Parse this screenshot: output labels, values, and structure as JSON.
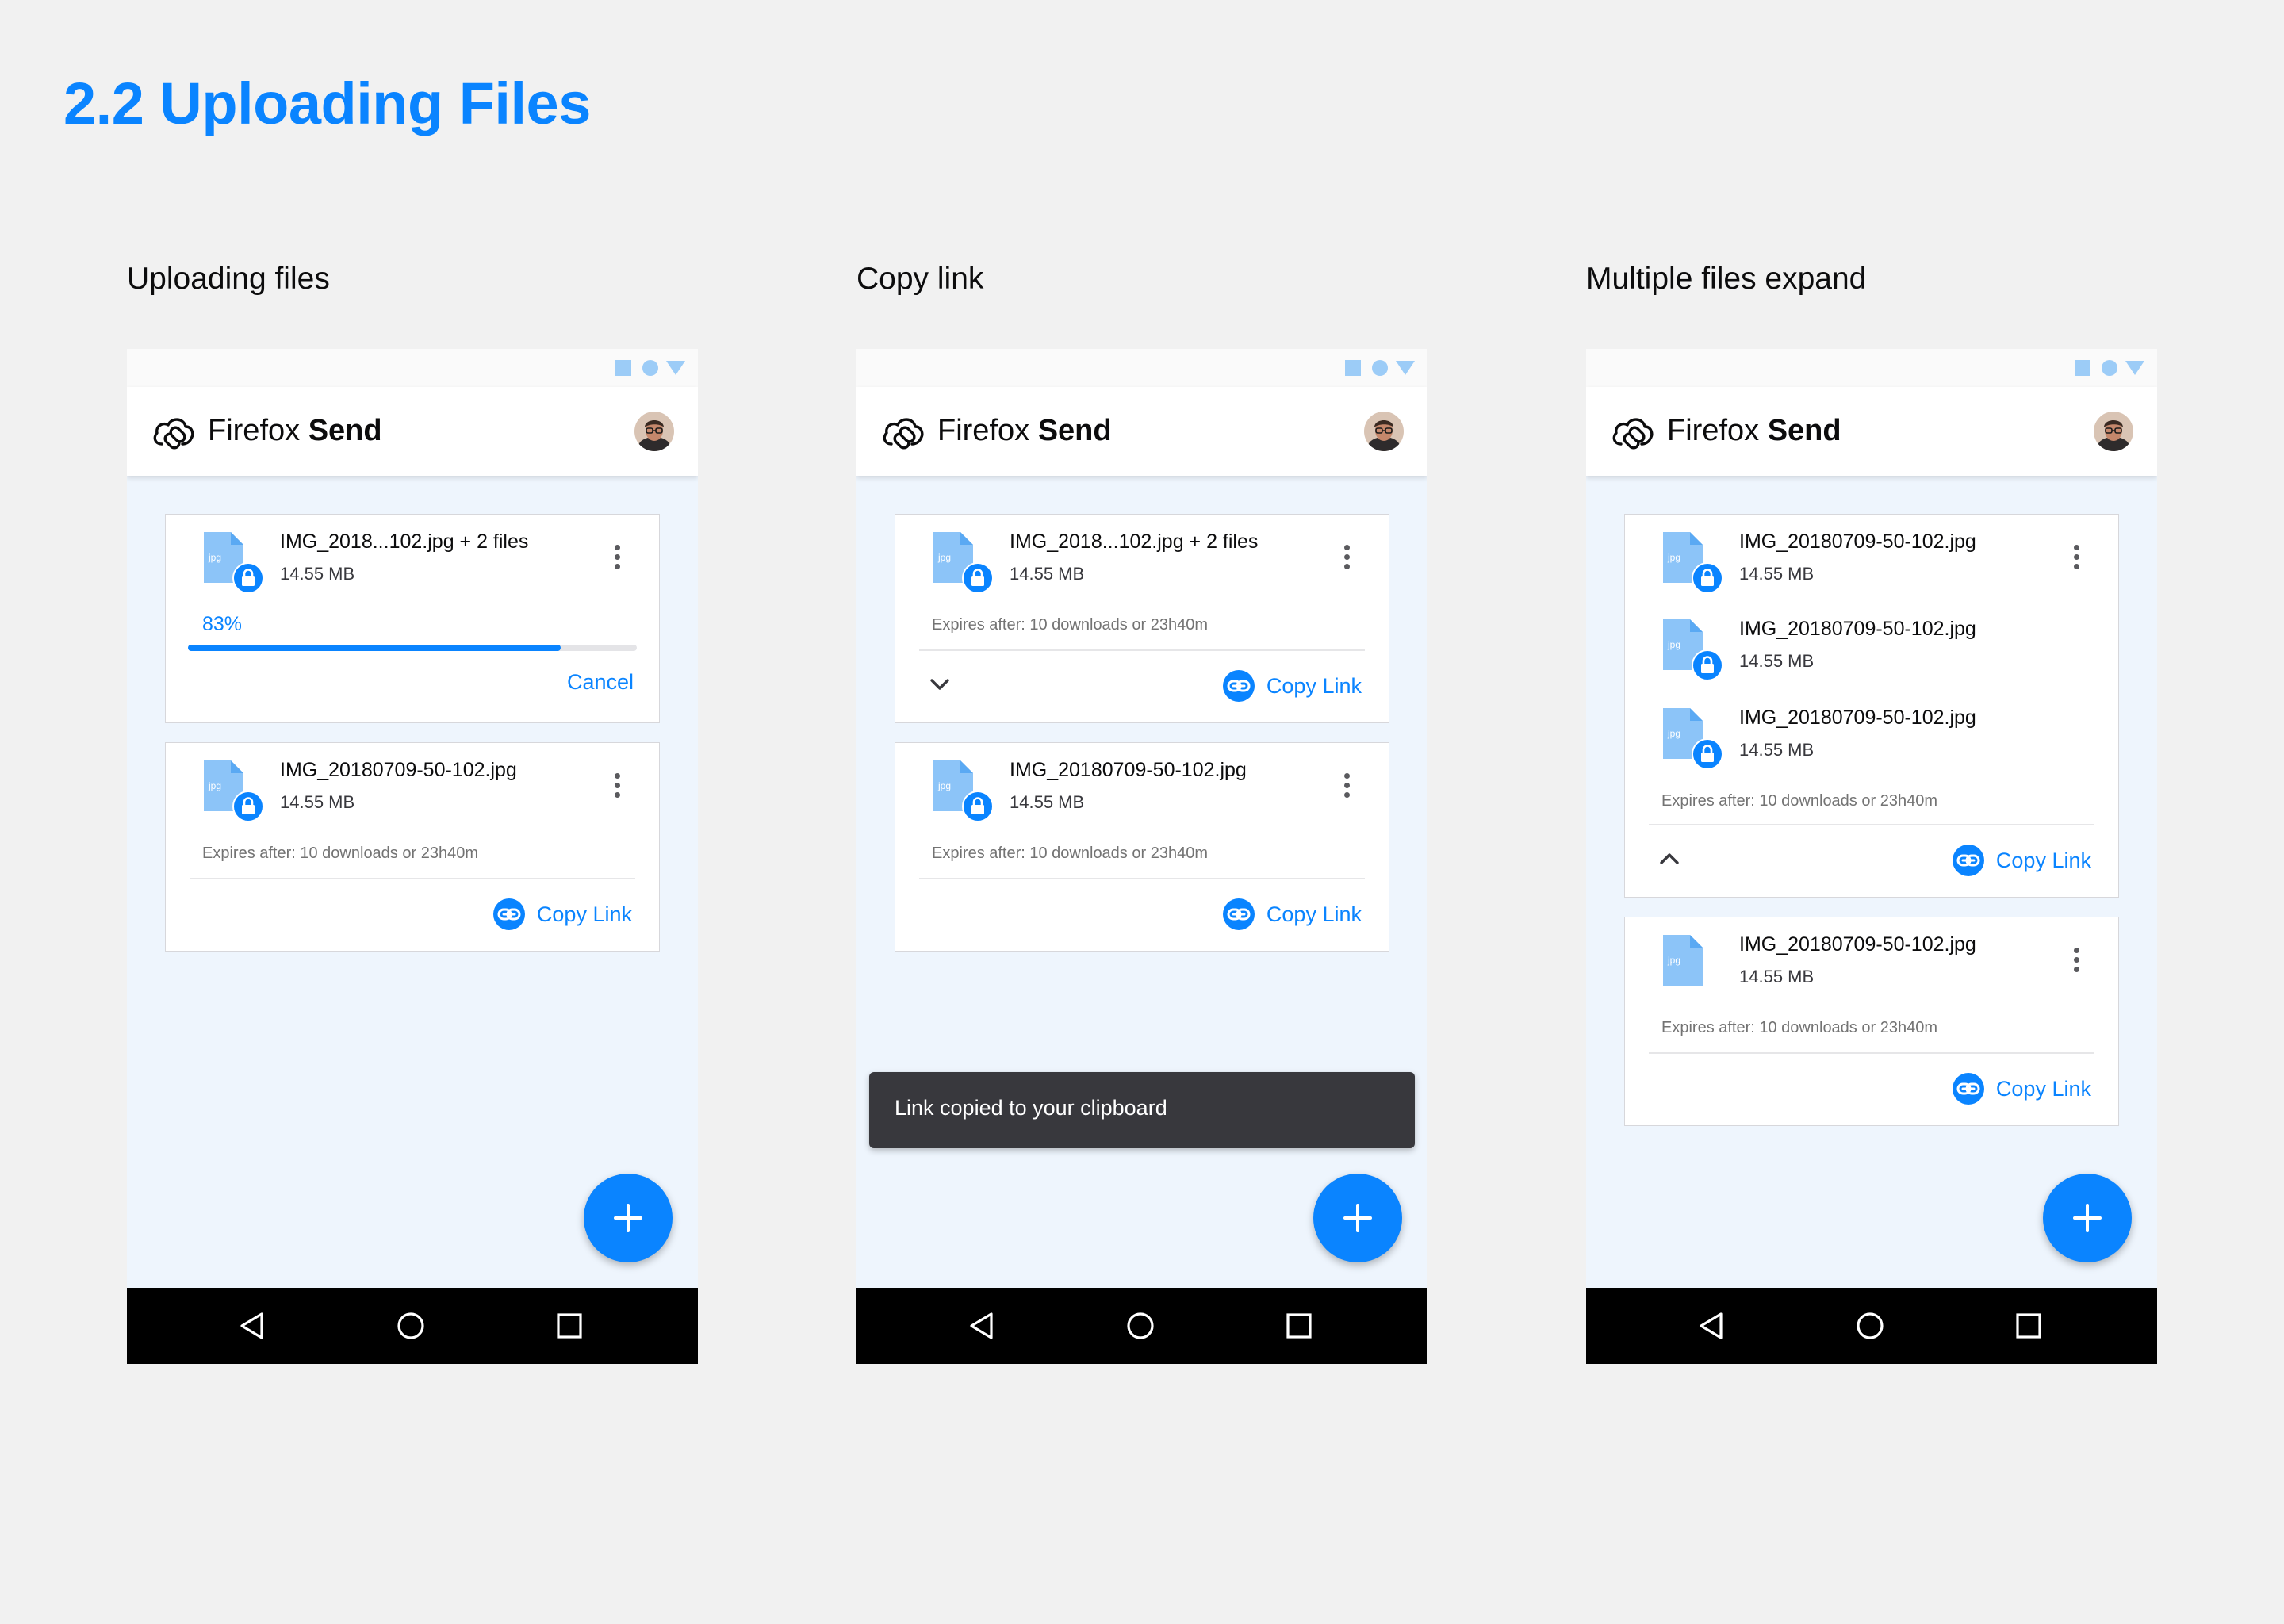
{
  "page": {
    "title": "2.2 Uploading Files"
  },
  "colors": {
    "accent": "#0a84ff",
    "card_border": "#d7d7db",
    "phone_background": "#eef5fd",
    "toast_background": "#38383d",
    "navbar": "#000000"
  },
  "icons": [
    "firefox-send-logo-icon",
    "jpg-file-icon",
    "lock-icon",
    "more-vert-icon",
    "link-icon",
    "chevron-down-icon",
    "chevron-up-icon",
    "plus-icon",
    "nav-back-icon",
    "nav-home-icon",
    "nav-recent-icon",
    "status-square-icon",
    "status-circle-icon",
    "status-triangle-icon",
    "avatar"
  ],
  "app": {
    "name_prefix": "Firefox",
    "name_bold": "Send"
  },
  "screens": [
    {
      "label": "Uploading files",
      "cards": [
        {
          "file_name": "IMG_2018...102.jpg + 2 files",
          "file_size": "14.55 MB",
          "progress_percent": 83,
          "progress_label": "83%",
          "cancel_label": "Cancel"
        },
        {
          "file_name": "IMG_20180709-50-102.jpg",
          "file_size": "14.55 MB",
          "expires": "Expires after: 10 downloads or 23h40m",
          "copy_label": "Copy Link"
        }
      ]
    },
    {
      "label": "Copy link",
      "cards": [
        {
          "file_name": "IMG_2018...102.jpg + 2 files",
          "file_size": "14.55 MB",
          "expires": "Expires after: 10 downloads or 23h40m",
          "copy_label": "Copy Link"
        },
        {
          "file_name": "IMG_20180709-50-102.jpg",
          "file_size": "14.55 MB",
          "expires": "Expires after: 10 downloads or 23h40m",
          "copy_label": "Copy Link"
        }
      ],
      "toast": "Link copied to your clipboard"
    },
    {
      "label": "Multiple files expand",
      "cards": [
        {
          "files": [
            {
              "file_name": "IMG_20180709-50-102.jpg",
              "file_size": "14.55 MB"
            },
            {
              "file_name": "IMG_20180709-50-102.jpg",
              "file_size": "14.55 MB"
            },
            {
              "file_name": "IMG_20180709-50-102.jpg",
              "file_size": "14.55 MB"
            }
          ],
          "expires": "Expires after: 10 downloads or 23h40m",
          "copy_label": "Copy Link"
        },
        {
          "file_name": "IMG_20180709-50-102.jpg",
          "file_size": "14.55 MB",
          "expires": "Expires after: 10 downloads or 23h40m",
          "copy_label": "Copy Link"
        }
      ]
    }
  ]
}
